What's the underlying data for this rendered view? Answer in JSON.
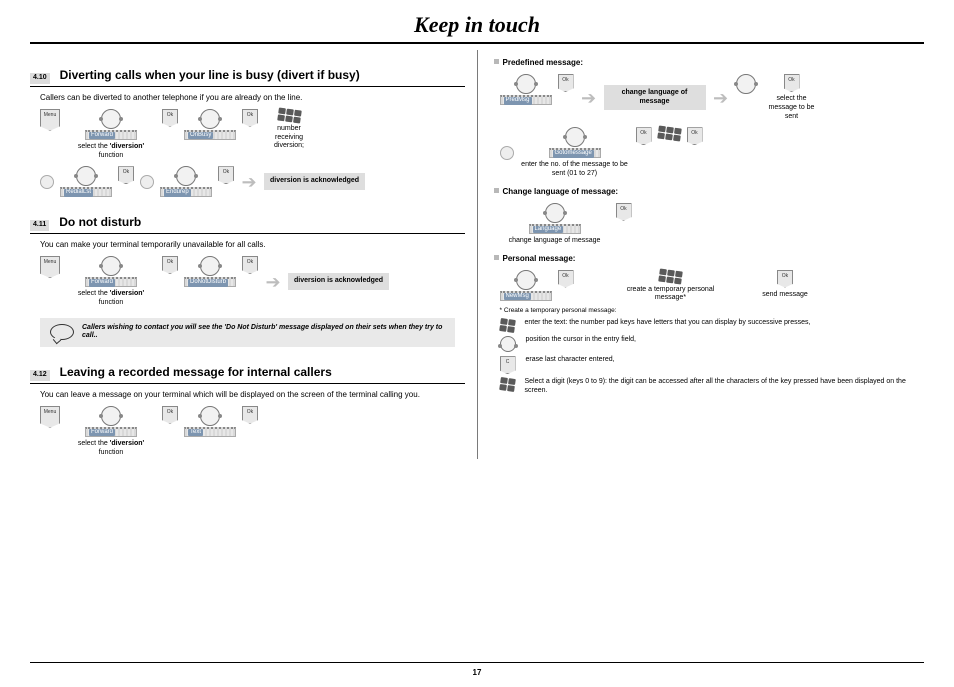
{
  "page": {
    "title": "Keep in touch",
    "number": "17"
  },
  "left": {
    "s410": {
      "num": "4.10",
      "title": "Diverting calls when your line is busy (divert if busy)",
      "intro": "Callers can be diverted to another telephone if you are already on the line.",
      "menu_key": "Menu",
      "ok_key": "Ok",
      "nav1": "Forward",
      "nav2": "OnBusy",
      "cap1_pre": "select the ",
      "cap1_bold": "'diversion'",
      "cap1_post": " function",
      "cap2": "number receiving diversion;",
      "nav3": "RedialLst",
      "nav4": "Endurep",
      "ack": "diversion is acknowledged"
    },
    "s411": {
      "num": "4.11",
      "title": "Do not disturb",
      "intro": "You can make your terminal temporarily unavailable for all calls.",
      "nav1": "Forward",
      "nav2": "DoNotDisturb",
      "cap1_pre": "select the ",
      "cap1_bold": "'diversion'",
      "cap1_post": " function",
      "ack": "diversion is acknowledged",
      "note": "Callers wishing to contact you will see the 'Do Not Disturb' message displayed on their sets when they try to call.."
    },
    "s412": {
      "num": "4.12",
      "title": "Leaving a recorded message for internal callers",
      "intro": "You can leave a message on your terminal which will be displayed on the screen of the terminal calling you.",
      "nav1": "Forward",
      "nav2": "Text",
      "cap1_pre": "select the ",
      "cap1_bold": "'diversion'",
      "cap1_post": " function"
    }
  },
  "right": {
    "predef": {
      "head": "Predefined message:",
      "nav1": "PredMsg",
      "box1": "change language of message",
      "cap1": "select the message to be sent",
      "nav2": "Gotomessage",
      "cap2": "enter the no. of the message to be sent (01 to 27)"
    },
    "lang": {
      "head": "Change language of message:",
      "nav": "Language",
      "cap": "change language of message"
    },
    "pers": {
      "head": "Personal message:",
      "nav": "NewMsg",
      "cap1": "create a temporary personal message*",
      "cap2": "send message",
      "foot": "* Create a temporary personal message:",
      "row1": "enter the text: the number pad keys have letters that you can display by successive presses,",
      "row2": "position the cursor in the entry field,",
      "row3": "erase last character entered,",
      "row4": "Select a digit (keys 0 to 9): the digit can be accessed after all the characters of the key pressed have been displayed on the screen."
    },
    "keys": {
      "ok": "Ok",
      "c": "C"
    }
  }
}
